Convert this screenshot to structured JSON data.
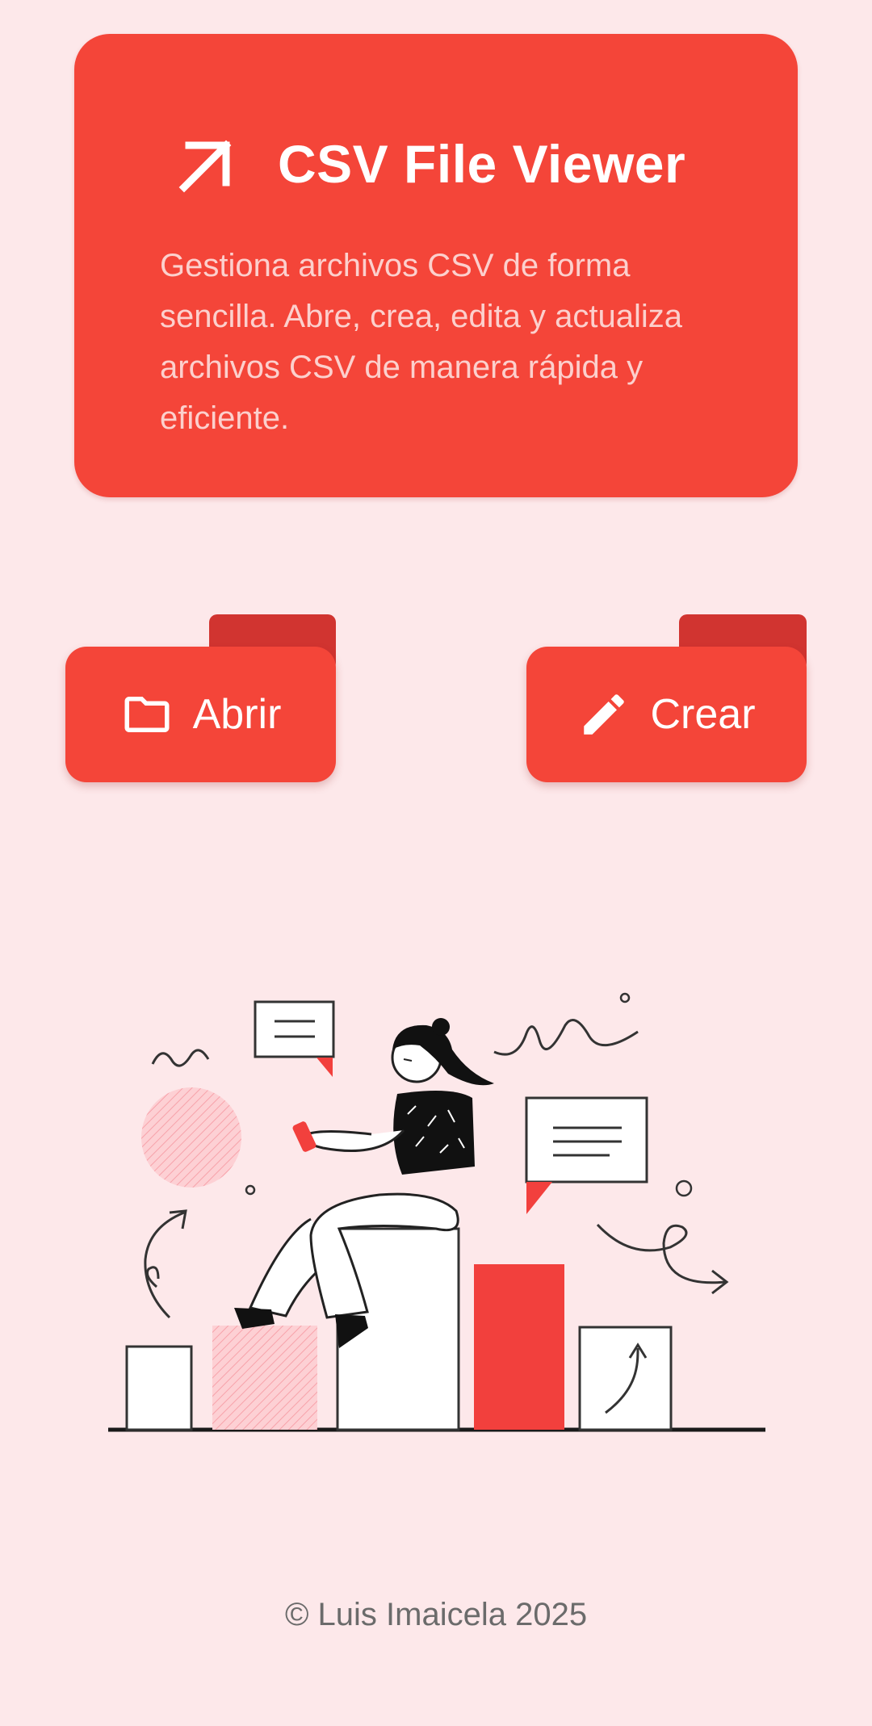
{
  "header": {
    "title": "CSV File Viewer",
    "description": "Gestiona archivos CSV de forma sencilla. Abre, crea, edita y actualiza archivos CSV de manera rápida y eficiente.",
    "icon": "arrow-up-right-icon"
  },
  "actions": {
    "open_label": "Abrir",
    "open_icon": "folder-icon",
    "create_label": "Crear",
    "create_icon": "pencil-icon"
  },
  "footer": {
    "copyright": "© Luis Imaicela 2025"
  },
  "colors": {
    "background": "#fde8ea",
    "accent": "#f44539",
    "accent_dark": "#d13430",
    "text_on_accent": "#ffffff",
    "footer_text": "#6b6b6b"
  }
}
